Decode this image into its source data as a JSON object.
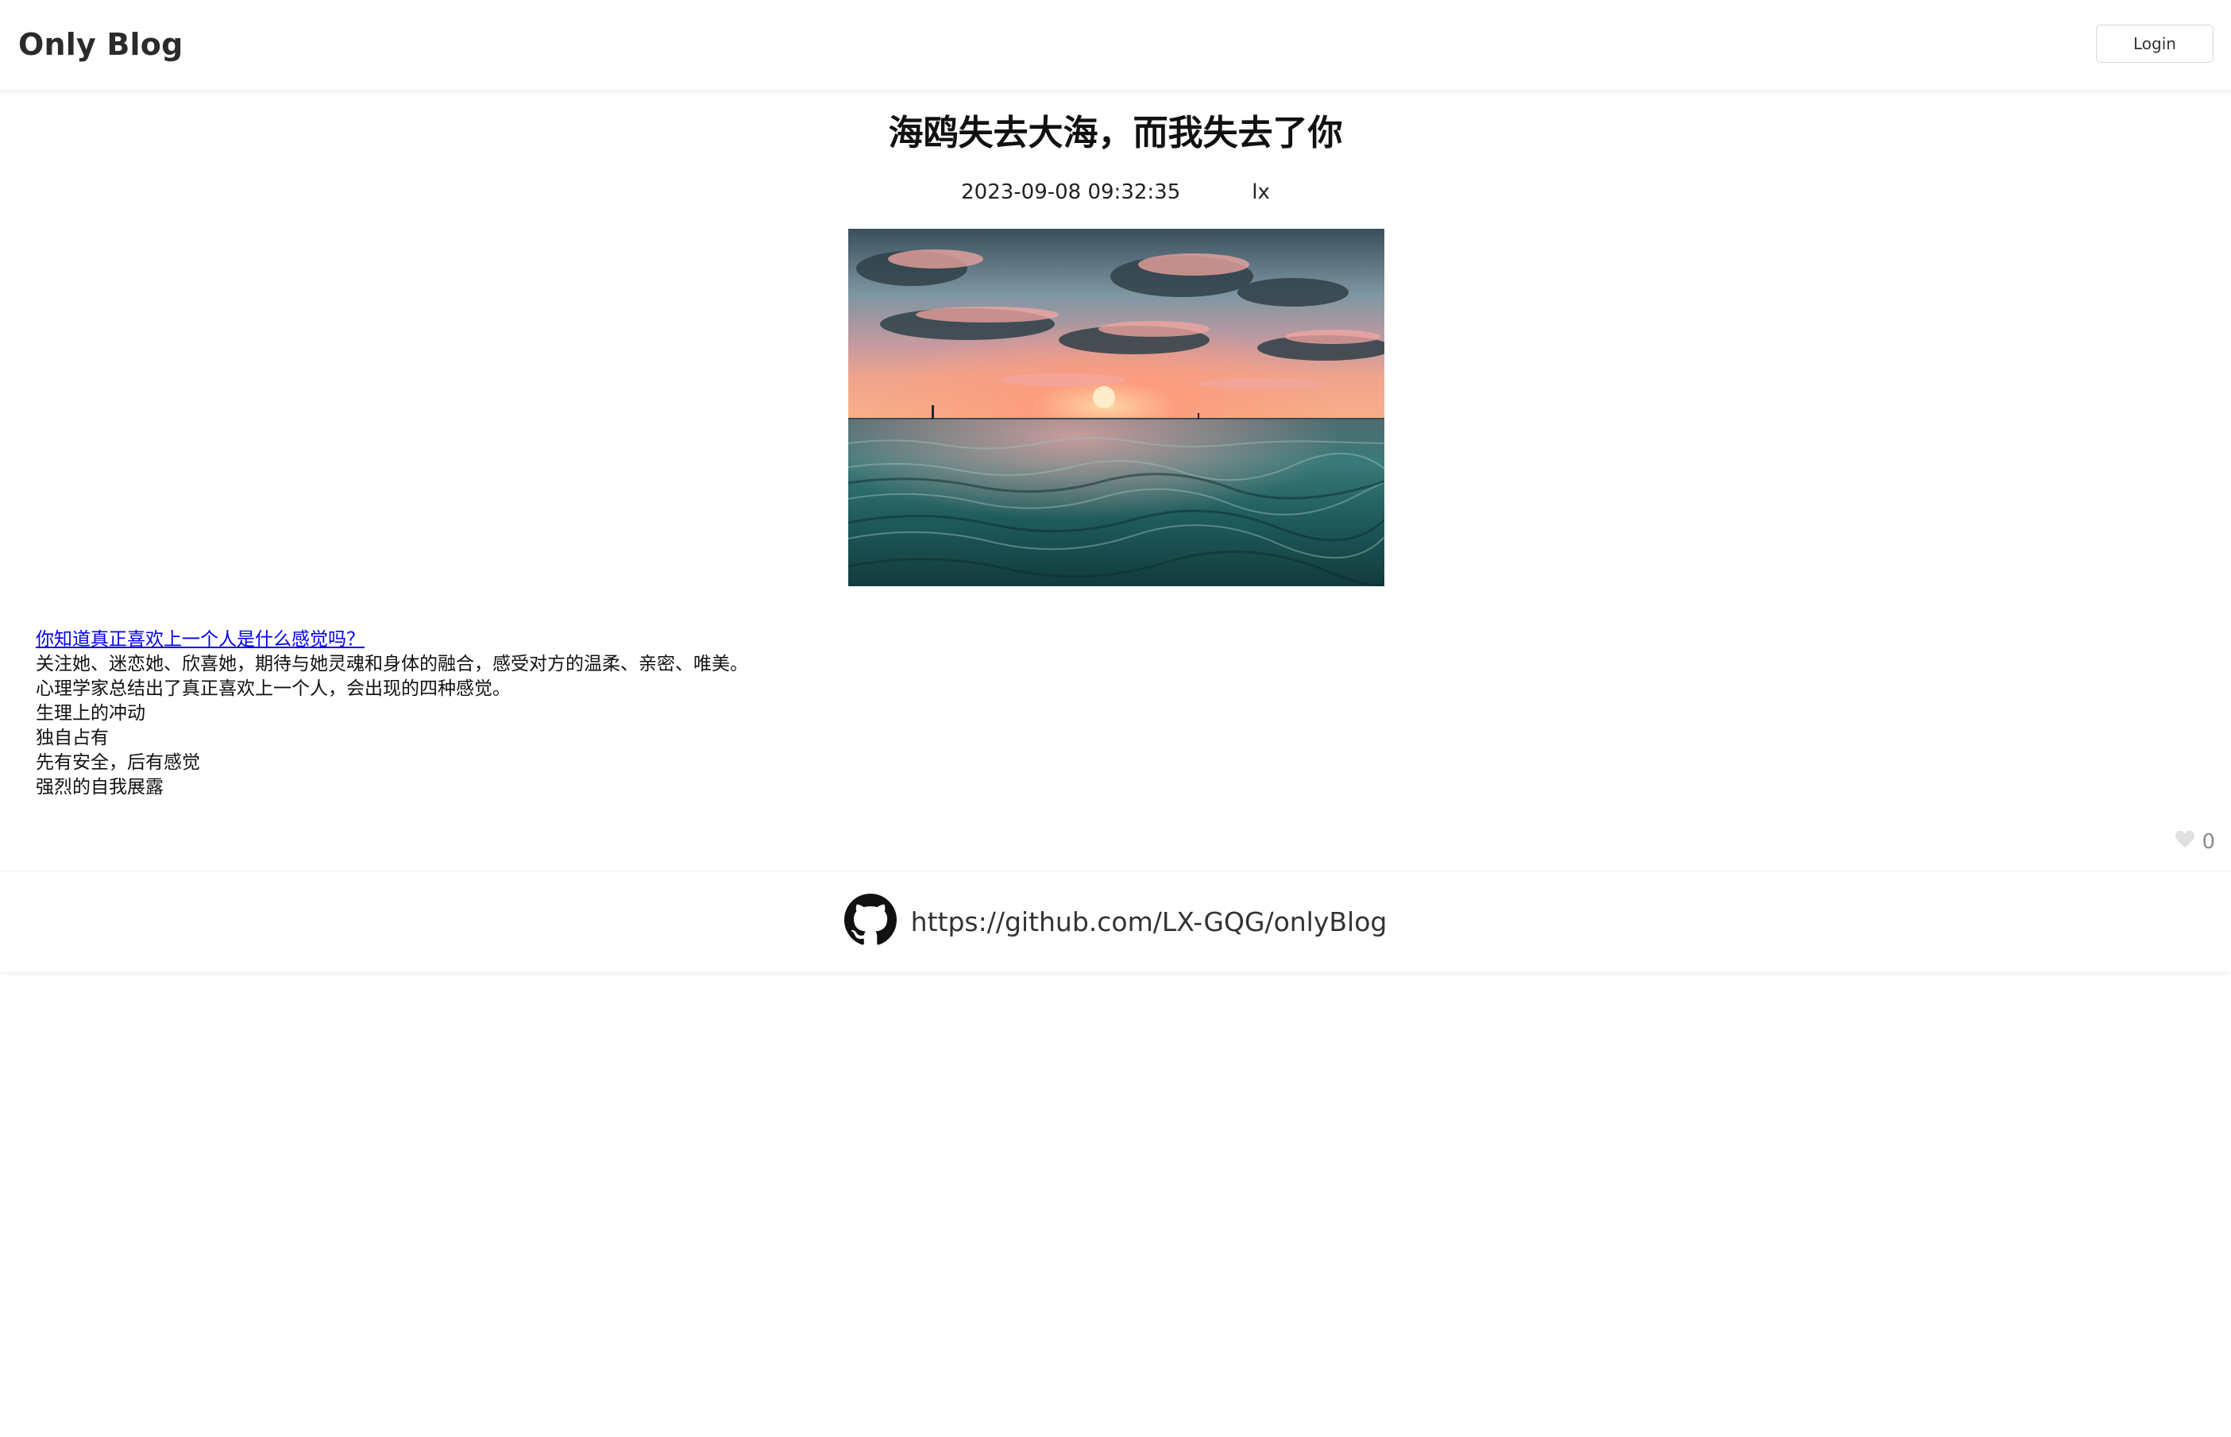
{
  "header": {
    "brand": "Only Blog",
    "login_label": "Login"
  },
  "post": {
    "title": "海鸥失去大海，而我失去了你",
    "date": "2023-09-08 09:32:35",
    "author": "lx",
    "content": {
      "link_text": "你知道真正喜欢上一个人是什么感觉吗？",
      "lines": [
        "关注她、迷恋她、欣喜她，期待与她灵魂和身体的融合，感受对方的温柔、亲密、唯美。",
        "心理学家总结出了真正喜欢上一个人，会出现的四种感觉。",
        "生理上的冲动",
        "独自占有",
        "先有安全，后有感觉",
        "强烈的自我展露"
      ]
    },
    "like_count": "0"
  },
  "footer": {
    "github_url": "https://github.com/LX-GQG/onlyBlog"
  }
}
